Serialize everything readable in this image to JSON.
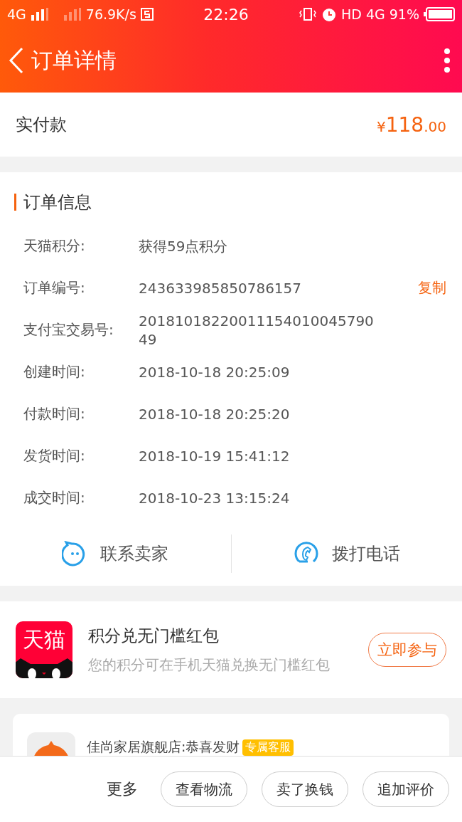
{
  "status_bar": {
    "network": "4G",
    "speed": "76.9K/s",
    "time": "22:26",
    "hd": "HD",
    "network2": "4G",
    "battery": "91%"
  },
  "header": {
    "title": "订单详情"
  },
  "payment": {
    "label": "实付款",
    "currency": "¥",
    "amount": "118",
    "cents": ".00"
  },
  "order_info": {
    "title": "订单信息",
    "rows": [
      {
        "label": "天猫积分:",
        "value": "获得59点积分"
      },
      {
        "label": "订单编号:",
        "value": "243633985850786157",
        "action": "复制"
      },
      {
        "label": "支付宝交易号:",
        "value": "2018101822001115401004579049"
      },
      {
        "label": "创建时间:",
        "value": "2018-10-18 20:25:09"
      },
      {
        "label": "付款时间:",
        "value": "2018-10-18 20:25:20"
      },
      {
        "label": "发货时间:",
        "value": "2018-10-19 15:41:12"
      },
      {
        "label": "成交时间:",
        "value": "2018-10-23 13:15:24"
      }
    ],
    "contacts": [
      {
        "kind": "chat",
        "label": "联系卖家"
      },
      {
        "kind": "phone",
        "label": "拨打电话"
      }
    ]
  },
  "promo": {
    "logo_text": "天猫",
    "title": "积分兑无门槛红包",
    "subtitle": "您的积分可在手机天猫兑换无门槛红包",
    "button": "立即参与"
  },
  "chat": {
    "shop": "佳尚家居旗舰店:恭喜发财",
    "badge": "专属客服"
  },
  "bottom_bar": {
    "more": "更多",
    "buttons": [
      "查看物流",
      "卖了换钱",
      "追加评价"
    ]
  }
}
